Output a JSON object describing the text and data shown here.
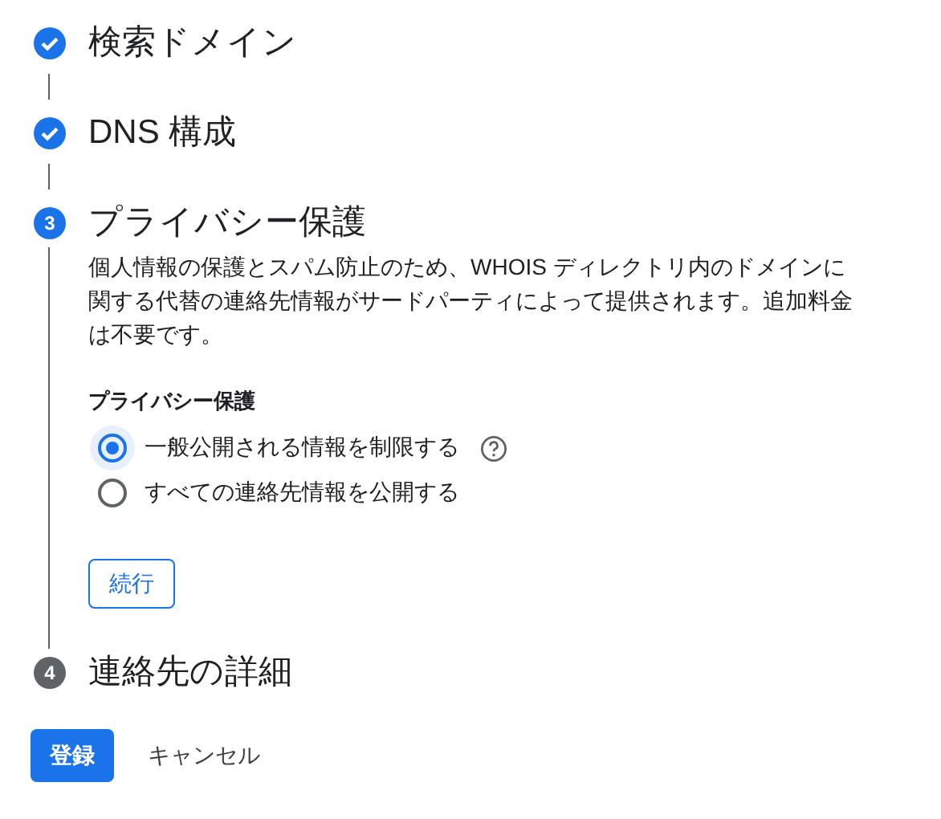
{
  "steps": [
    {
      "kind": "done",
      "title": "検索ドメイン"
    },
    {
      "kind": "done",
      "title": "DNS 構成"
    },
    {
      "kind": "active",
      "number": "3",
      "title": "プライバシー保護",
      "description": "個人情報の保護とスパム防止のため、WHOIS ディレクトリ内のドメインに関する代替の連絡先情報がサードパーティによって提供されます。追加料金は不要です。",
      "group_label": "プライバシー保護",
      "options": [
        {
          "label": "一般公開される情報を制限する",
          "selected": true,
          "help": true
        },
        {
          "label": "すべての連絡先情報を公開する",
          "selected": false,
          "help": false
        }
      ],
      "continue_button": "続行"
    },
    {
      "kind": "pending",
      "number": "4",
      "title": "連絡先の詳細"
    }
  ],
  "actions": {
    "submit": "登録",
    "cancel": "キャンセル"
  }
}
